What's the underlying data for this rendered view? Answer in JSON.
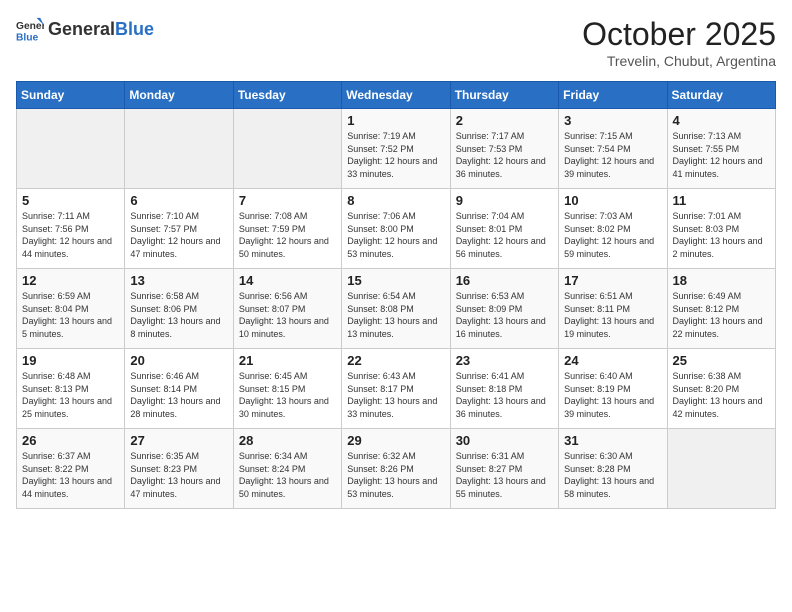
{
  "header": {
    "logo_general": "General",
    "logo_blue": "Blue",
    "month": "October 2025",
    "location": "Trevelin, Chubut, Argentina"
  },
  "weekdays": [
    "Sunday",
    "Monday",
    "Tuesday",
    "Wednesday",
    "Thursday",
    "Friday",
    "Saturday"
  ],
  "weeks": [
    [
      {
        "day": "",
        "info": ""
      },
      {
        "day": "",
        "info": ""
      },
      {
        "day": "",
        "info": ""
      },
      {
        "day": "1",
        "info": "Sunrise: 7:19 AM\nSunset: 7:52 PM\nDaylight: 12 hours and 33 minutes."
      },
      {
        "day": "2",
        "info": "Sunrise: 7:17 AM\nSunset: 7:53 PM\nDaylight: 12 hours and 36 minutes."
      },
      {
        "day": "3",
        "info": "Sunrise: 7:15 AM\nSunset: 7:54 PM\nDaylight: 12 hours and 39 minutes."
      },
      {
        "day": "4",
        "info": "Sunrise: 7:13 AM\nSunset: 7:55 PM\nDaylight: 12 hours and 41 minutes."
      }
    ],
    [
      {
        "day": "5",
        "info": "Sunrise: 7:11 AM\nSunset: 7:56 PM\nDaylight: 12 hours and 44 minutes."
      },
      {
        "day": "6",
        "info": "Sunrise: 7:10 AM\nSunset: 7:57 PM\nDaylight: 12 hours and 47 minutes."
      },
      {
        "day": "7",
        "info": "Sunrise: 7:08 AM\nSunset: 7:59 PM\nDaylight: 12 hours and 50 minutes."
      },
      {
        "day": "8",
        "info": "Sunrise: 7:06 AM\nSunset: 8:00 PM\nDaylight: 12 hours and 53 minutes."
      },
      {
        "day": "9",
        "info": "Sunrise: 7:04 AM\nSunset: 8:01 PM\nDaylight: 12 hours and 56 minutes."
      },
      {
        "day": "10",
        "info": "Sunrise: 7:03 AM\nSunset: 8:02 PM\nDaylight: 12 hours and 59 minutes."
      },
      {
        "day": "11",
        "info": "Sunrise: 7:01 AM\nSunset: 8:03 PM\nDaylight: 13 hours and 2 minutes."
      }
    ],
    [
      {
        "day": "12",
        "info": "Sunrise: 6:59 AM\nSunset: 8:04 PM\nDaylight: 13 hours and 5 minutes."
      },
      {
        "day": "13",
        "info": "Sunrise: 6:58 AM\nSunset: 8:06 PM\nDaylight: 13 hours and 8 minutes."
      },
      {
        "day": "14",
        "info": "Sunrise: 6:56 AM\nSunset: 8:07 PM\nDaylight: 13 hours and 10 minutes."
      },
      {
        "day": "15",
        "info": "Sunrise: 6:54 AM\nSunset: 8:08 PM\nDaylight: 13 hours and 13 minutes."
      },
      {
        "day": "16",
        "info": "Sunrise: 6:53 AM\nSunset: 8:09 PM\nDaylight: 13 hours and 16 minutes."
      },
      {
        "day": "17",
        "info": "Sunrise: 6:51 AM\nSunset: 8:11 PM\nDaylight: 13 hours and 19 minutes."
      },
      {
        "day": "18",
        "info": "Sunrise: 6:49 AM\nSunset: 8:12 PM\nDaylight: 13 hours and 22 minutes."
      }
    ],
    [
      {
        "day": "19",
        "info": "Sunrise: 6:48 AM\nSunset: 8:13 PM\nDaylight: 13 hours and 25 minutes."
      },
      {
        "day": "20",
        "info": "Sunrise: 6:46 AM\nSunset: 8:14 PM\nDaylight: 13 hours and 28 minutes."
      },
      {
        "day": "21",
        "info": "Sunrise: 6:45 AM\nSunset: 8:15 PM\nDaylight: 13 hours and 30 minutes."
      },
      {
        "day": "22",
        "info": "Sunrise: 6:43 AM\nSunset: 8:17 PM\nDaylight: 13 hours and 33 minutes."
      },
      {
        "day": "23",
        "info": "Sunrise: 6:41 AM\nSunset: 8:18 PM\nDaylight: 13 hours and 36 minutes."
      },
      {
        "day": "24",
        "info": "Sunrise: 6:40 AM\nSunset: 8:19 PM\nDaylight: 13 hours and 39 minutes."
      },
      {
        "day": "25",
        "info": "Sunrise: 6:38 AM\nSunset: 8:20 PM\nDaylight: 13 hours and 42 minutes."
      }
    ],
    [
      {
        "day": "26",
        "info": "Sunrise: 6:37 AM\nSunset: 8:22 PM\nDaylight: 13 hours and 44 minutes."
      },
      {
        "day": "27",
        "info": "Sunrise: 6:35 AM\nSunset: 8:23 PM\nDaylight: 13 hours and 47 minutes."
      },
      {
        "day": "28",
        "info": "Sunrise: 6:34 AM\nSunset: 8:24 PM\nDaylight: 13 hours and 50 minutes."
      },
      {
        "day": "29",
        "info": "Sunrise: 6:32 AM\nSunset: 8:26 PM\nDaylight: 13 hours and 53 minutes."
      },
      {
        "day": "30",
        "info": "Sunrise: 6:31 AM\nSunset: 8:27 PM\nDaylight: 13 hours and 55 minutes."
      },
      {
        "day": "31",
        "info": "Sunrise: 6:30 AM\nSunset: 8:28 PM\nDaylight: 13 hours and 58 minutes."
      },
      {
        "day": "",
        "info": ""
      }
    ]
  ]
}
